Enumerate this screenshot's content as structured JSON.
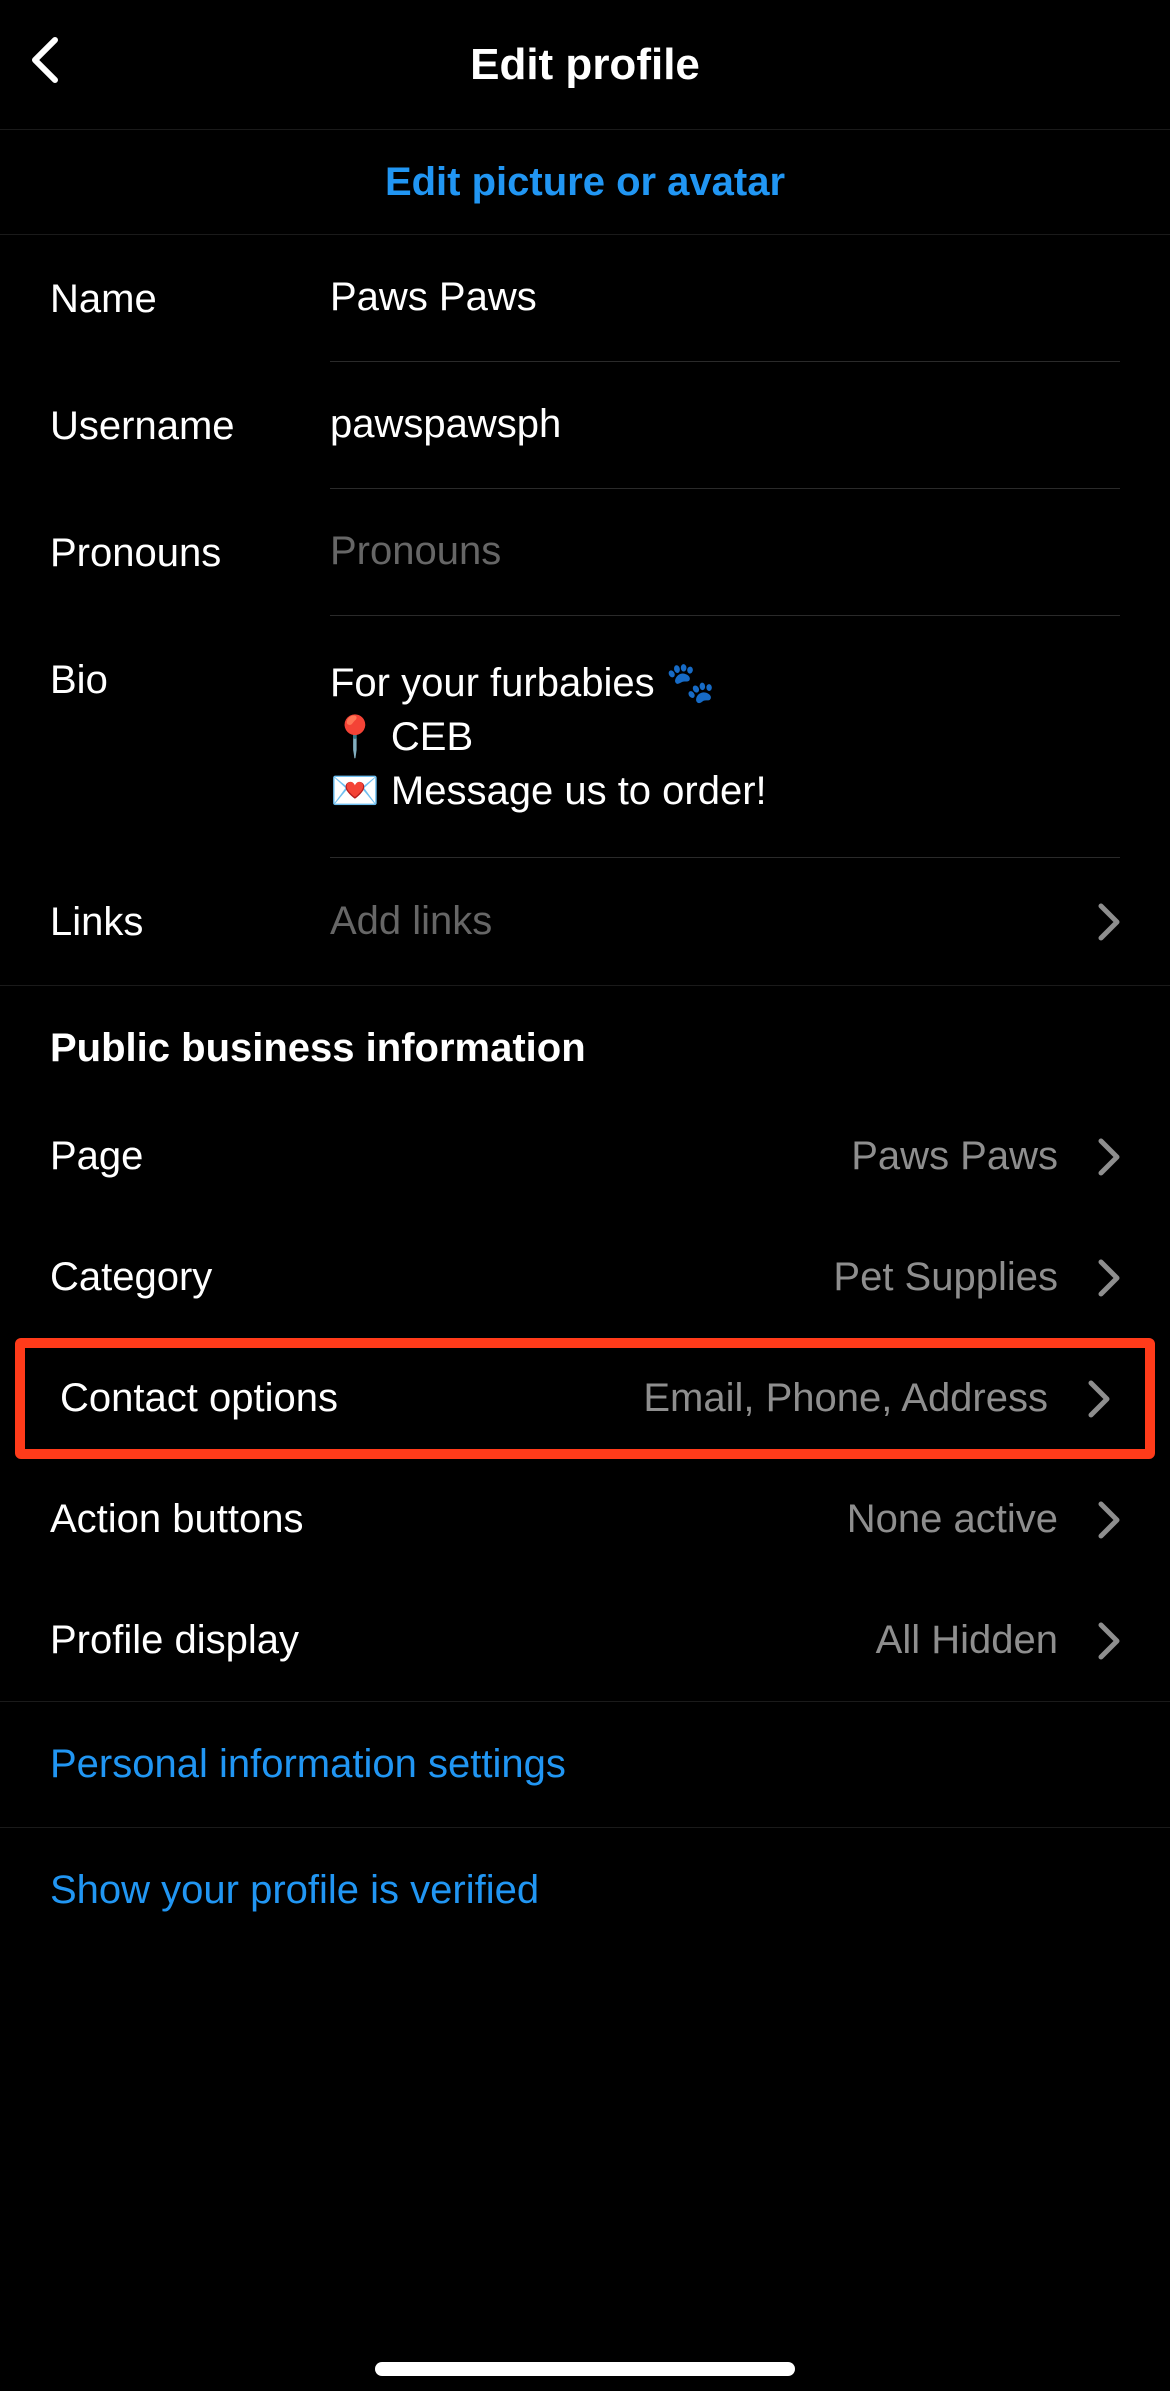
{
  "header": {
    "title": "Edit profile"
  },
  "editPicture": {
    "label": "Edit picture or avatar"
  },
  "form": {
    "name": {
      "label": "Name",
      "value": "Paws Paws"
    },
    "username": {
      "label": "Username",
      "value": "pawspawsph"
    },
    "pronouns": {
      "label": "Pronouns",
      "placeholder": "Pronouns"
    },
    "bio": {
      "label": "Bio",
      "value": "For your furbabies 🐾\n📍 CEB\n💌 Message us to order!"
    },
    "links": {
      "label": "Links",
      "placeholder": "Add links"
    }
  },
  "business": {
    "header": "Public business information",
    "page": {
      "label": "Page",
      "value": "Paws Paws"
    },
    "category": {
      "label": "Category",
      "value": "Pet Supplies"
    },
    "contact": {
      "label": "Contact options",
      "value": "Email, Phone, Address"
    },
    "actions": {
      "label": "Action buttons",
      "value": "None active"
    },
    "display": {
      "label": "Profile display",
      "value": "All Hidden"
    }
  },
  "links": {
    "personal": "Personal information settings",
    "verified": "Show your profile is verified"
  }
}
